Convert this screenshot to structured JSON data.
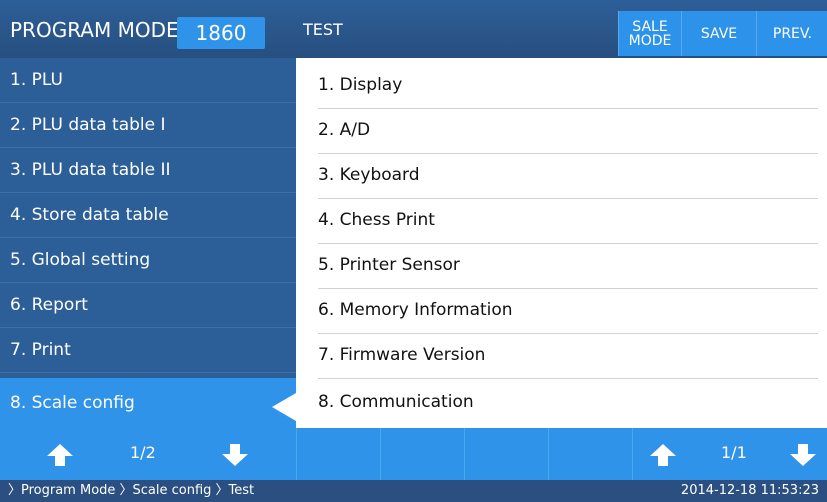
{
  "header": {
    "title": "PROGRAM MODE",
    "code": "1860",
    "screen": "TEST",
    "buttons": [
      {
        "label": "SALE\nMODE"
      },
      {
        "label": "SAVE"
      },
      {
        "label": "PREV."
      }
    ]
  },
  "sidebar": {
    "items": [
      {
        "label": "1. PLU"
      },
      {
        "label": "2. PLU data table I"
      },
      {
        "label": "3. PLU data table II"
      },
      {
        "label": "4. Store data table"
      },
      {
        "label": "5. Global setting"
      },
      {
        "label": "6. Report"
      },
      {
        "label": "7. Print"
      },
      {
        "label": "8. Scale config"
      }
    ],
    "selected_index": 7
  },
  "panel": {
    "items": [
      {
        "label": "1. Display"
      },
      {
        "label": "2. A/D"
      },
      {
        "label": "3. Keyboard"
      },
      {
        "label": "4. Chess Print"
      },
      {
        "label": "5. Printer Sensor"
      },
      {
        "label": "6. Memory Information"
      },
      {
        "label": "7. Firmware Version"
      },
      {
        "label": "8. Communication"
      }
    ]
  },
  "paging": {
    "left_page": "1/2",
    "right_page": "1/1",
    "icons": [
      "up-arrow-icon",
      "down-arrow-icon"
    ]
  },
  "footer": {
    "breadcrumb": "〉Program Mode 〉Scale config 〉Test",
    "datetime": "2014-12-18 11:53:23"
  },
  "colors": {
    "dark_blue": "#2c5f98",
    "accent_blue": "#2f93ea",
    "panel_bg": "#ffffff"
  }
}
